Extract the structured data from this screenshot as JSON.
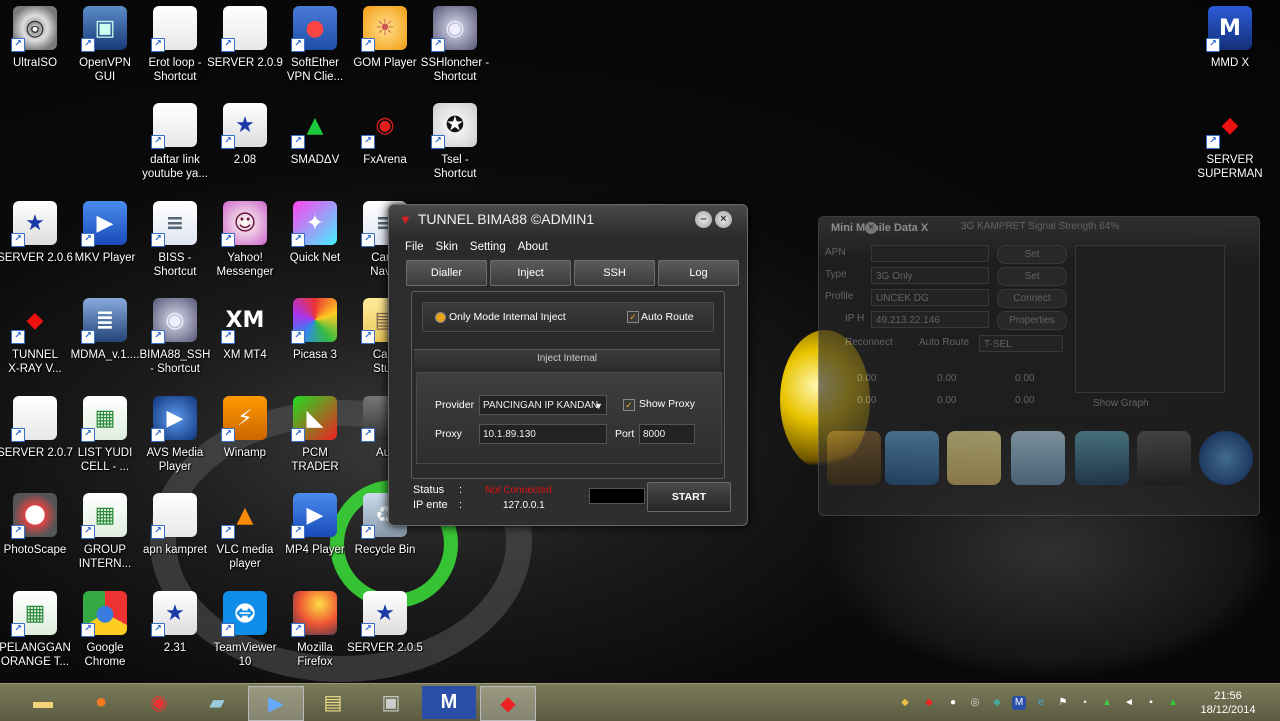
{
  "desktop": {
    "icons": [
      {
        "label": "UltraISO",
        "icon": "disc-icon"
      },
      {
        "label": "OpenVPN\nGUI",
        "icon": "network-monitor-icon"
      },
      {
        "label": "Erot loop -\nShortcut",
        "icon": "blank-file-icon"
      },
      {
        "label": "SERVER 2.0.9",
        "icon": "blank-file-icon"
      },
      {
        "label": "SoftEther\nVPN Clie...",
        "icon": "softether-icon"
      },
      {
        "label": "GOM Player",
        "icon": "gom-player-icon"
      },
      {
        "label": "SSHloncher -\nShortcut",
        "icon": "globe-shield-icon"
      },
      {
        "label": "daftar link\nyoutube ya...",
        "icon": "blank-file-icon"
      },
      {
        "label": "2.08",
        "icon": "star-shield-icon"
      },
      {
        "label": "SMADΔV",
        "icon": "smadav-icon"
      },
      {
        "label": "FxArena",
        "icon": "fxarena-icon"
      },
      {
        "label": "Tsel -\nShortcut",
        "icon": "pentagram-icon"
      },
      {
        "label": "SERVER 2.0.6",
        "icon": "star-shield-icon"
      },
      {
        "label": "MKV Player",
        "icon": "play-arrow-icon"
      },
      {
        "label": "BISS -\nShortcut",
        "icon": "document-icon"
      },
      {
        "label": "Yahoo!\nMessenger",
        "icon": "yahoo-smiley-icon"
      },
      {
        "label": "Quick Net",
        "icon": "quick-net-icon"
      },
      {
        "label": "Cano\nNavig",
        "icon": "document-icon"
      },
      {
        "label": "TUNNEL\nX-RAY V...",
        "icon": "red-dragon-icon"
      },
      {
        "label": "MDMA_v.1....",
        "icon": "database-icon"
      },
      {
        "label": "BIMA88_SSH\n- Shortcut",
        "icon": "globe-shield-icon"
      },
      {
        "label": "XM MT4",
        "icon": "xm-icon"
      },
      {
        "label": "Picasa 3",
        "icon": "picasa-icon"
      },
      {
        "label": "Cam\nStud",
        "icon": "notes-icon"
      },
      {
        "label": "SERVER 2.0.7",
        "icon": "blank-file-icon"
      },
      {
        "label": "LIST YUDI\nCELL - ...",
        "icon": "spreadsheet-icon"
      },
      {
        "label": "AVS Media\nPlayer",
        "icon": "avs-player-icon"
      },
      {
        "label": "Winamp",
        "icon": "winamp-icon"
      },
      {
        "label": "PCM\nTRADER",
        "icon": "pcm-trader-icon"
      },
      {
        "label": "Aur",
        "icon": "generic-app-icon"
      },
      {
        "label": "PhotoScape",
        "icon": "photoscape-icon"
      },
      {
        "label": "GROUP\nINTERN...",
        "icon": "spreadsheet-icon"
      },
      {
        "label": "apn kampret",
        "icon": "blank-file-icon"
      },
      {
        "label": "VLC media\nplayer",
        "icon": "vlc-cone-icon"
      },
      {
        "label": "MP4 Player",
        "icon": "play-arrow-icon"
      },
      {
        "label": "Recycle Bin",
        "icon": "recycle-bin-icon"
      },
      {
        "label": "PELANGGAN\nORANGE T...",
        "icon": "spreadsheet-icon"
      },
      {
        "label": "Google\nChrome",
        "icon": "chrome-icon"
      },
      {
        "label": "2.31",
        "icon": "star-shield-icon"
      },
      {
        "label": "TeamViewer\n10",
        "icon": "teamviewer-icon"
      },
      {
        "label": "Mozilla\nFirefox",
        "icon": "firefox-icon"
      },
      {
        "label": "SERVER 2.0.5",
        "icon": "star-shield-icon"
      },
      {
        "label": "MMD X",
        "icon": "mmd-icon"
      },
      {
        "label": "SERVER\nSUPERMAN",
        "icon": "superman-icon"
      }
    ]
  },
  "tunnel_window": {
    "title": "TUNNEL BIMA88 ©ADMIN1",
    "menu": [
      "File",
      "Skin",
      "Setting",
      "About"
    ],
    "tabs": [
      "Dialler",
      "Inject",
      "SSH",
      "Log"
    ],
    "mode_label": "Only Mode Internal Inject",
    "auto_route_label": "Auto Route",
    "inject_header": "Inject Internal",
    "provider_label": "Provider",
    "provider_value": "PANCINGAN IP KANDAN",
    "show_proxy_label": "Show Proxy",
    "proxy_label": "Proxy",
    "proxy_value": "10.1.89.130",
    "port_label": "Port",
    "port_value": "8000",
    "status_label": "Status",
    "status_value": "Not Connected",
    "ip_label": "IP ente",
    "ip_value": "127.0.0.1",
    "colon": ":",
    "start_label": "START",
    "status_color": "#e01010",
    "accent_color": "#e8a21a"
  },
  "mobile_window": {
    "title": "Mini Mobile Data X",
    "signal": "3G KAMPRET Signal Strength 64%",
    "apn_label": "APN",
    "type_label": "Type",
    "type_value": "3G Only",
    "profile_label": "Profile",
    "profile_value": "UNCEK DG",
    "ip_label": "IP H",
    "ip_value": "49.213.22.146",
    "set_label": "Set",
    "connect_label": "Connect",
    "properties_label": "Properties",
    "reconnect_label": "Reconnect",
    "auto_route_label": "Auto Route",
    "tsel_value": "T-SEL",
    "zero": "0.00",
    "show_graph_label": "Show Graph"
  },
  "taskbar": {
    "time": "21:56",
    "date": "18/12/2014",
    "apps": [
      "folder-icon",
      "firefox-icon",
      "chrome-icon",
      "notepad-icon",
      "media-player-icon",
      "sticky-notes-icon",
      "camera-icon",
      "mmd-icon",
      "superman-icon"
    ]
  }
}
